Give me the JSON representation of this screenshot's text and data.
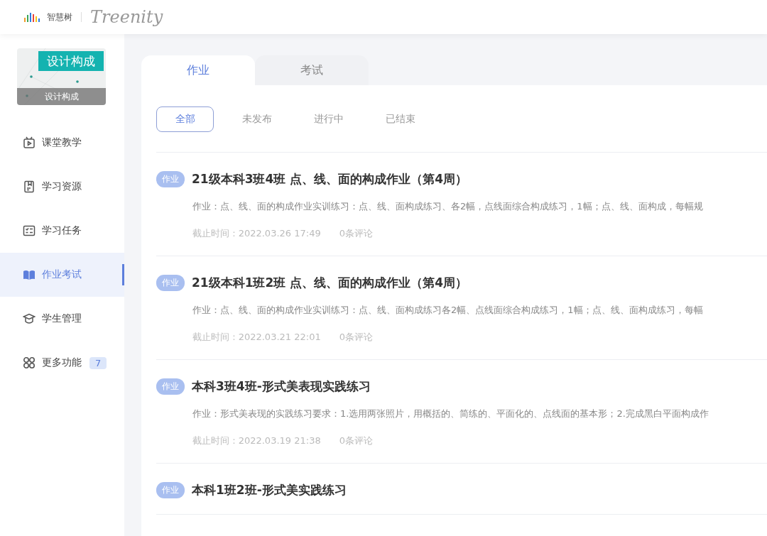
{
  "header": {
    "brand": "智慧树",
    "product": "Treenity"
  },
  "course": {
    "banner": "设计构成",
    "caption": "设计构成"
  },
  "sidebar": {
    "items": [
      {
        "label": "课堂教学",
        "selected": false
      },
      {
        "label": "学习资源",
        "selected": false
      },
      {
        "label": "学习任务",
        "selected": false
      },
      {
        "label": "作业考试",
        "selected": true
      },
      {
        "label": "学生管理",
        "selected": false
      },
      {
        "label": "更多功能",
        "selected": false,
        "badge": "7"
      }
    ]
  },
  "tabs": [
    {
      "label": "作业",
      "selected": true
    },
    {
      "label": "考试",
      "selected": false
    }
  ],
  "filters": [
    {
      "label": "全部",
      "selected": true
    },
    {
      "label": "未发布",
      "selected": false
    },
    {
      "label": "进行中",
      "selected": false
    },
    {
      "label": "已结束",
      "selected": false
    }
  ],
  "assignments": [
    {
      "tag": "作业",
      "title": "21级本科3班4班 点、线、面的构成作业（第4周）",
      "description": "作业：点、线、面的构成作业实训练习：点、线、面构成练习、各2幅，点线面综合构成练习，1幅；点、线、面构成，每幅规",
      "deadline": "截止时间 : 2022.03.26 17:49",
      "comments": "0条评论"
    },
    {
      "tag": "作业",
      "title": "21级本科1班2班 点、线、面的构成作业（第4周）",
      "description": "作业：点、线、面的构成作业实训练习：点、线、面构成练习各2幅、点线面综合构成练习，1幅；点、线、面构成练习，每幅",
      "deadline": "截止时间 : 2022.03.21 22:01",
      "comments": "0条评论"
    },
    {
      "tag": "作业",
      "title": "本科3班4班-形式美表现实践练习",
      "description": "作业：形式美表现的实践练习要求：1.选用两张照片，用概括的、简练的、平面化的、点线面的基本形；2.完成黑白平面构成作",
      "deadline": "截止时间 : 2022.03.19 21:38",
      "comments": "0条评论"
    },
    {
      "tag": "作业",
      "title": "本科1班2班-形式美实践练习"
    }
  ]
}
